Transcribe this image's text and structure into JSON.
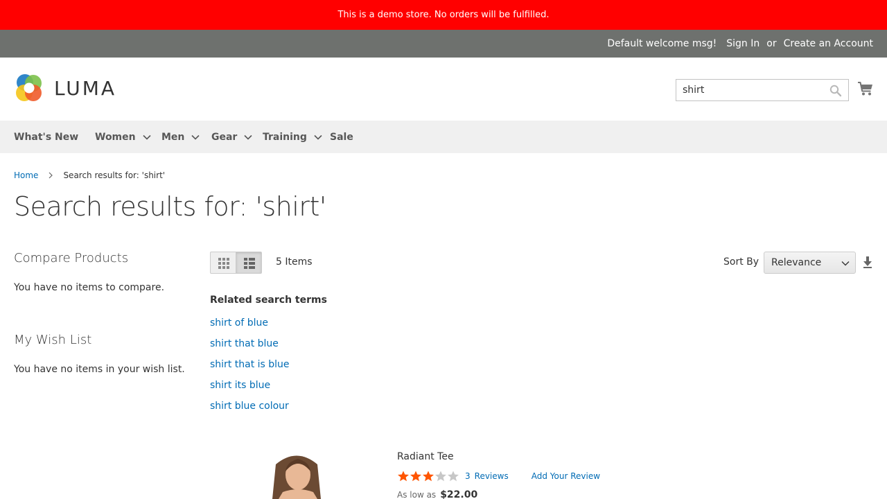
{
  "demo_notice": "This is a demo store. No orders will be fulfilled.",
  "panel": {
    "welcome": "Default welcome msg!",
    "sign_in": "Sign In",
    "or": "or",
    "create_account": "Create an Account"
  },
  "header": {
    "logo_text": "LUMA",
    "search_value": "shirt"
  },
  "nav": {
    "items": [
      {
        "label": "What's New",
        "dropdown": false
      },
      {
        "label": "Women",
        "dropdown": true
      },
      {
        "label": "Men",
        "dropdown": true
      },
      {
        "label": "Gear",
        "dropdown": true
      },
      {
        "label": "Training",
        "dropdown": true
      },
      {
        "label": "Sale",
        "dropdown": false
      }
    ]
  },
  "breadcrumbs": {
    "home": "Home",
    "current": "Search results for: 'shirt'"
  },
  "page_title": "Search results for: 'shirt'",
  "sidebar": {
    "compare_title": "Compare Products",
    "compare_empty": "You have no items to compare.",
    "wishlist_title": "My Wish List",
    "wishlist_empty": "You have no items in your wish list."
  },
  "toolbar": {
    "amount_number": "5",
    "amount_label": "Items",
    "sort_label": "Sort By",
    "sort_selected": "Relevance"
  },
  "related": {
    "title": "Related search terms",
    "terms": [
      "shirt of blue",
      "shirt that blue",
      "shirt that is blue",
      "shirt its blue",
      "shirt blue colour"
    ]
  },
  "products": [
    {
      "name": "Radiant Tee",
      "rating_stars": 3,
      "rating_max": 5,
      "reviews_count": "3",
      "reviews_label": "Reviews",
      "add_review": "Add Your Review",
      "price_label": "As low as",
      "price": "$22.00"
    }
  ],
  "colors": {
    "demo_bar": "#ff0000",
    "panel_bar": "#6e716e",
    "link": "#006bb4",
    "star_on": "#ff5501",
    "star_off": "#c7c7c7"
  }
}
